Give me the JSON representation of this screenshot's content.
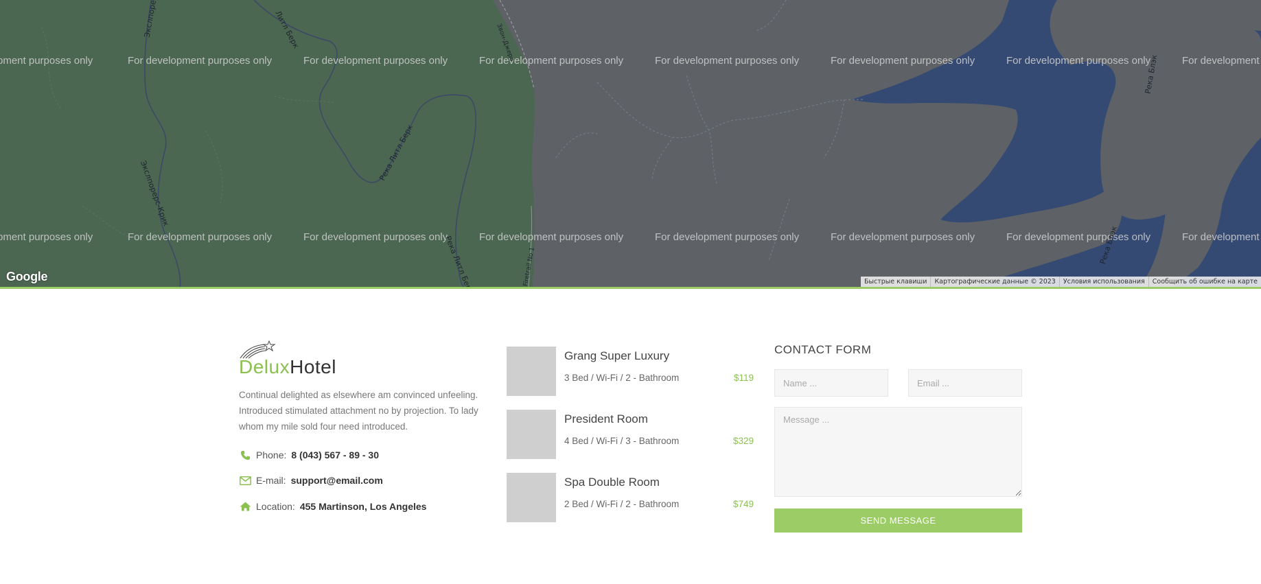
{
  "map": {
    "watermark_text": "For development purposes only",
    "watermark_partial_left": "pment purposes only",
    "watermark_partial_right": "For development",
    "labels": {
      "creek_top": "Экслпорерс-Крик",
      "creek_bottom": "Экслпорерс-Крик",
      "river_top": "Литл Берк",
      "river_mid": "Река Литл Берк",
      "river_low": "Река Литл Берк",
      "road": "Звон-Джеро",
      "trail": "Firetrail No 1",
      "river_east_top": "Река Блэк",
      "river_east_bottom": "Река Блэк"
    },
    "google_logo": "Google",
    "attribution": [
      "Быстрые клавиши",
      "Картографические данные © 2023",
      "Условия использования",
      "Сообщить об ошибке на карте"
    ]
  },
  "about": {
    "brand_first": "Delux",
    "brand_second": "Hotel",
    "description": "Continual delighted as elsewhere am convinced unfeeling. Introduced stimulated attachment no by projection. To lady whom my mile sold four need introduced.",
    "phone_label": "Phone:",
    "phone_value": "8 (043) 567 - 89 - 30",
    "email_label": "E-mail:",
    "email_value": "support@email.com",
    "location_label": "Location:",
    "location_value": "455 Martinson, Los Angeles",
    "icons": [
      "star-logo-icon",
      "phone-icon",
      "envelope-icon",
      "home-icon"
    ],
    "accent_color": "#8cc152"
  },
  "rooms": [
    {
      "name": "Grang Super Luxury",
      "details": "3 Bed / Wi-Fi / 2 - Bathroom",
      "price": "$119"
    },
    {
      "name": "President Room",
      "details": "4 Bed / Wi-Fi / 3 - Bathroom",
      "price": "$329"
    },
    {
      "name": "Spa Double Room",
      "details": "2 Bed / Wi-Fi / 2 - Bathroom",
      "price": "$749"
    }
  ],
  "contact": {
    "title": "CONTACT FORM",
    "name_placeholder": "Name ...",
    "email_placeholder": "Email ...",
    "message_placeholder": "Message ...",
    "send_label": "SEND MESSAGE",
    "button_color": "#9ccc65"
  }
}
